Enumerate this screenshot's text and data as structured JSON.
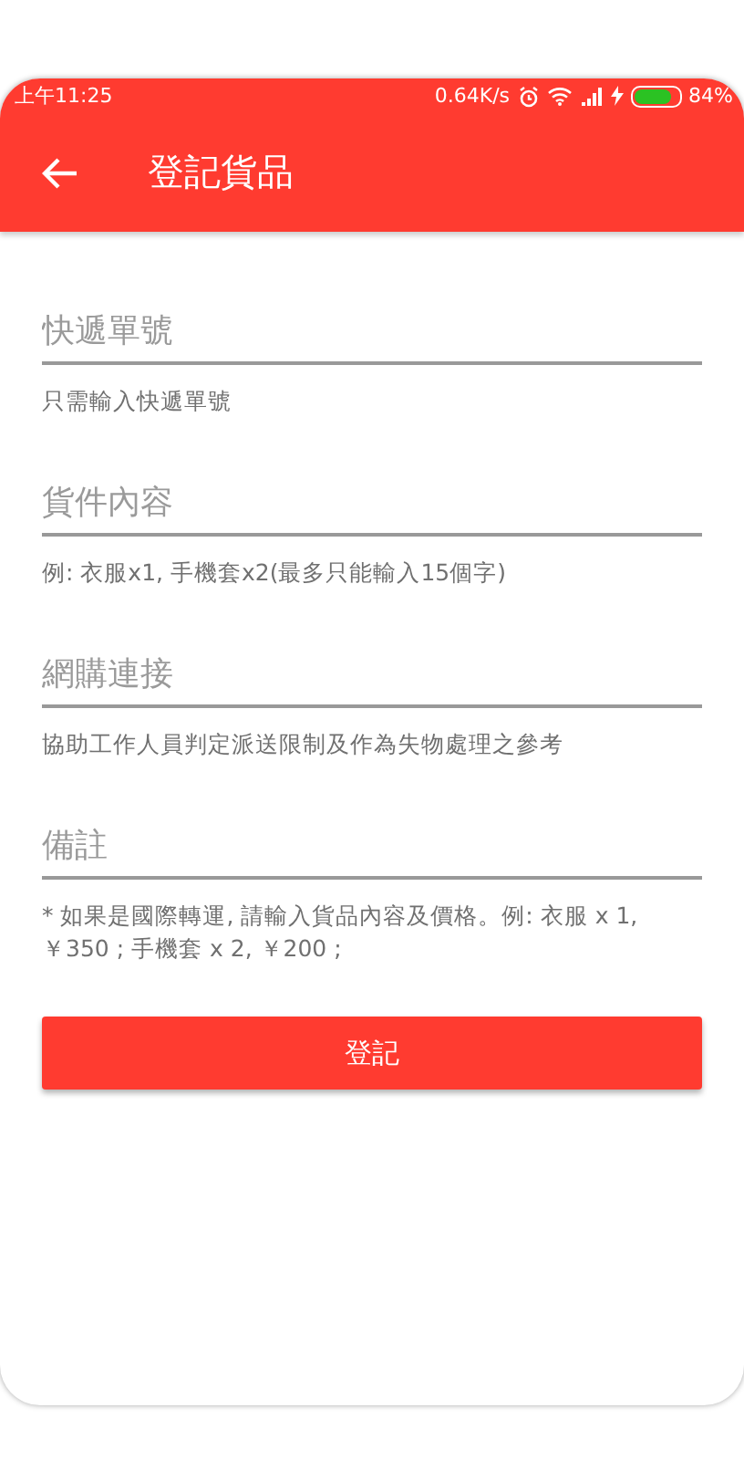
{
  "status_bar": {
    "time": "上午11:25",
    "speed": "0.64K/s",
    "battery": "84%"
  },
  "app_bar": {
    "title": "登記貨品"
  },
  "fields": [
    {
      "placeholder": "快遞單號",
      "helper": "只需輸入快遞單號"
    },
    {
      "placeholder": "貨件內容",
      "helper": "例: 衣服x1, 手機套x2(最多只能輸入15個字)"
    },
    {
      "placeholder": "網購連接",
      "helper": "協助工作人員判定派送限制及作為失物處理之參考"
    },
    {
      "placeholder": "備註",
      "helper": "* 如果是國際轉運, 請輸入貨品內容及價格。例: 衣服 x 1, ￥350 ; 手機套 x 2, ￥200 ;"
    }
  ],
  "submit_button": "登記"
}
